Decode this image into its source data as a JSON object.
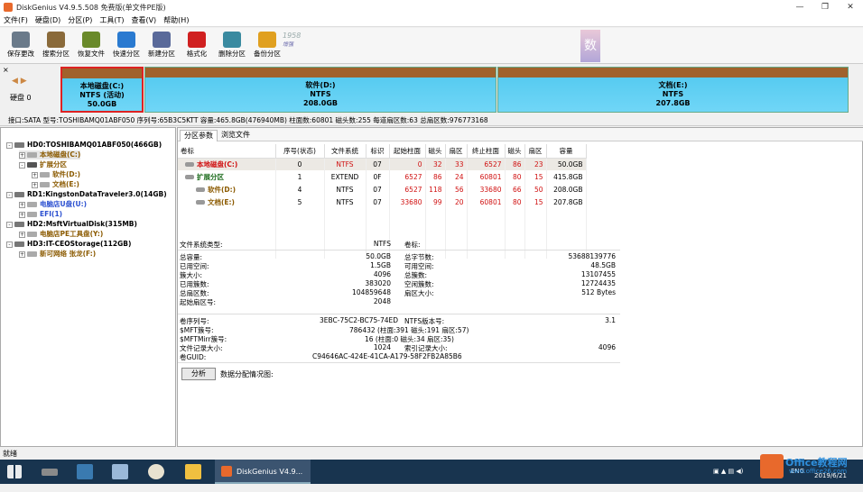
{
  "window": {
    "title": "DiskGenius V4.9.5.508 免费版(单文件PE版)"
  },
  "menu": [
    "文件(F)",
    "硬盘(D)",
    "分区(P)",
    "工具(T)",
    "查看(V)",
    "帮助(H)"
  ],
  "toolbar": [
    {
      "label": "保存更改",
      "icon": "save-icon",
      "color": "#6a7a8a"
    },
    {
      "label": "搜索分区",
      "icon": "magnifier-icon",
      "color": "#8a6a3a"
    },
    {
      "label": "恢复文件",
      "icon": "recover-icon",
      "color": "#6a8a2a"
    },
    {
      "label": "快速分区",
      "icon": "quick-partition-icon",
      "color": "#2a7ad0"
    },
    {
      "label": "新建分区",
      "icon": "new-partition-icon",
      "color": "#5a6a9a"
    },
    {
      "label": "格式化",
      "icon": "format-icon",
      "color": "#d02020"
    },
    {
      "label": "删除分区",
      "icon": "trash-icon",
      "color": "#3a8aa0"
    },
    {
      "label": "备份分区",
      "icon": "backup-icon",
      "color": "#e0a020"
    }
  ],
  "ads": {
    "left": "1958",
    "left_sub": "增强",
    "right": "数"
  },
  "diskmap": {
    "disk_label": "硬盘 0",
    "partitions": [
      {
        "name": "本地磁盘(C:)",
        "fs": "NTFS (活动)",
        "size": "50.0GB",
        "selected": true
      },
      {
        "name": "软件(D:)",
        "fs": "NTFS",
        "size": "208.0GB",
        "selected": false
      },
      {
        "name": "文档(E:)",
        "fs": "NTFS",
        "size": "207.8GB",
        "selected": false
      }
    ]
  },
  "diskinfo": "接口:SATA  型号:TOSHIBAMQ01ABF050  序列号:65B3C5KTT  容量:465.8GB(476940MB)  柱面数:60801  磁头数:255  每道扇区数:63  总扇区数:976773168",
  "tree": [
    {
      "text": "HD0:TOSHIBAMQ01ABF050(466GB)",
      "style": "bold",
      "indent": 0,
      "toggle": "-",
      "icon": "disk"
    },
    {
      "text": "本地磁盘(C:)",
      "style": "brown",
      "indent": 1,
      "toggle": "+",
      "icon": "part",
      "selected": true
    },
    {
      "text": "扩展分区",
      "style": "brown",
      "indent": 1,
      "toggle": "-",
      "icon": "ext"
    },
    {
      "text": "软件(D:)",
      "style": "brown",
      "indent": 2,
      "toggle": "+",
      "icon": "part"
    },
    {
      "text": "文档(E:)",
      "style": "brown",
      "indent": 2,
      "toggle": "+",
      "icon": "part"
    },
    {
      "text": "RD1:KingstonDataTraveler3.0(14GB)",
      "style": "bold",
      "indent": 0,
      "toggle": "-",
      "icon": "disk"
    },
    {
      "text": "电脑店U盘(U:)",
      "style": "blue",
      "indent": 1,
      "toggle": "+",
      "icon": "part"
    },
    {
      "text": "EFI(1)",
      "style": "blue",
      "indent": 1,
      "toggle": "+",
      "icon": "part"
    },
    {
      "text": "HD2:MsftVirtualDisk(315MB)",
      "style": "bold",
      "indent": 0,
      "toggle": "-",
      "icon": "disk"
    },
    {
      "text": "电脑店PE工具盘(Y:)",
      "style": "brown",
      "indent": 1,
      "toggle": "+",
      "icon": "part"
    },
    {
      "text": "HD3:IT-CEOStorage(112GB)",
      "style": "bold",
      "indent": 0,
      "toggle": "-",
      "icon": "disk"
    },
    {
      "text": "新可网络 张龙(F:)",
      "style": "brown",
      "indent": 1,
      "toggle": "+",
      "icon": "part"
    }
  ],
  "tabs": [
    "分区参数",
    "浏览文件"
  ],
  "table": {
    "headers": [
      "卷标",
      "序号(状态)",
      "文件系统",
      "标识",
      "起始柱面",
      "磁头",
      "扇区",
      "终止柱面",
      "磁头",
      "扇区",
      "容量"
    ],
    "rows": [
      {
        "cells": [
          "本地磁盘(C:)",
          "0",
          "NTFS",
          "07",
          "0",
          "32",
          "33",
          "6527",
          "86",
          "23",
          "50.0GB"
        ],
        "red": [
          0,
          2,
          4,
          5,
          6,
          7,
          8,
          9
        ],
        "selected": true,
        "indent": 0
      },
      {
        "cells": [
          "扩展分区",
          "1",
          "EXTEND",
          "0F",
          "6527",
          "86",
          "24",
          "60801",
          "80",
          "15",
          "415.8GB"
        ],
        "red": [
          4,
          5,
          6,
          7,
          8,
          9
        ],
        "selected": false,
        "indent": 0
      },
      {
        "cells": [
          "软件(D:)",
          "4",
          "NTFS",
          "07",
          "6527",
          "118",
          "56",
          "33680",
          "66",
          "50",
          "208.0GB"
        ],
        "red": [
          4,
          5,
          6,
          7,
          8,
          9
        ],
        "selected": false,
        "indent": 1
      },
      {
        "cells": [
          "文档(E:)",
          "5",
          "NTFS",
          "07",
          "33680",
          "99",
          "20",
          "60801",
          "80",
          "15",
          "207.8GB"
        ],
        "red": [
          4,
          5,
          6,
          7,
          8,
          9
        ],
        "selected": false,
        "indent": 1
      }
    ]
  },
  "info": {
    "fs_type_label": "文件系统类型:",
    "fs_type": "NTFS",
    "volume_label_label": "卷标:",
    "left": [
      {
        "k": "总容量:",
        "v": "50.0GB"
      },
      {
        "k": "已用空间:",
        "v": "1.5GB"
      },
      {
        "k": "簇大小:",
        "v": "4096"
      },
      {
        "k": "已用簇数:",
        "v": "383020"
      },
      {
        "k": "总扇区数:",
        "v": "104859648"
      },
      {
        "k": "起始扇区号:",
        "v": "2048"
      }
    ],
    "right": [
      {
        "k": "总字节数:",
        "v": "53688139776"
      },
      {
        "k": "可用空间:",
        "v": "48.5GB"
      },
      {
        "k": "总簇数:",
        "v": "13107455"
      },
      {
        "k": "空闲簇数:",
        "v": "12724435"
      },
      {
        "k": "扇区大小:",
        "v": "512 Bytes"
      }
    ],
    "serial_label": "卷序列号:",
    "serial": "3EBC-75C2-BC75-74ED",
    "ntfs_ver_label": "NTFS版本号:",
    "ntfs_ver": "3.1",
    "mft_label": "$MFT簇号:",
    "mft": "786432 (柱面:391 磁头:191 扇区:57)",
    "mftmirr_label": "$MFTMirr簇号:",
    "mftmirr": "16 (柱面:0 磁头:34 扇区:35)",
    "rec_label": "文件记录大小:",
    "rec": "1024",
    "idx_label": "索引记录大小:",
    "idx": "4096",
    "guid_label": "卷GUID:",
    "guid": "C94646AC-424E-41CA-A179-58F2FB2A85B6",
    "analyze": "分析",
    "dist_label": "数据分配情况图:"
  },
  "status": "就绪",
  "taskbar": {
    "app": "DiskGenius V4.9...",
    "lang": "ENG",
    "date": "2019/6/21",
    "watermark": "Office教程网",
    "watermark_url": "www.office26.com"
  }
}
